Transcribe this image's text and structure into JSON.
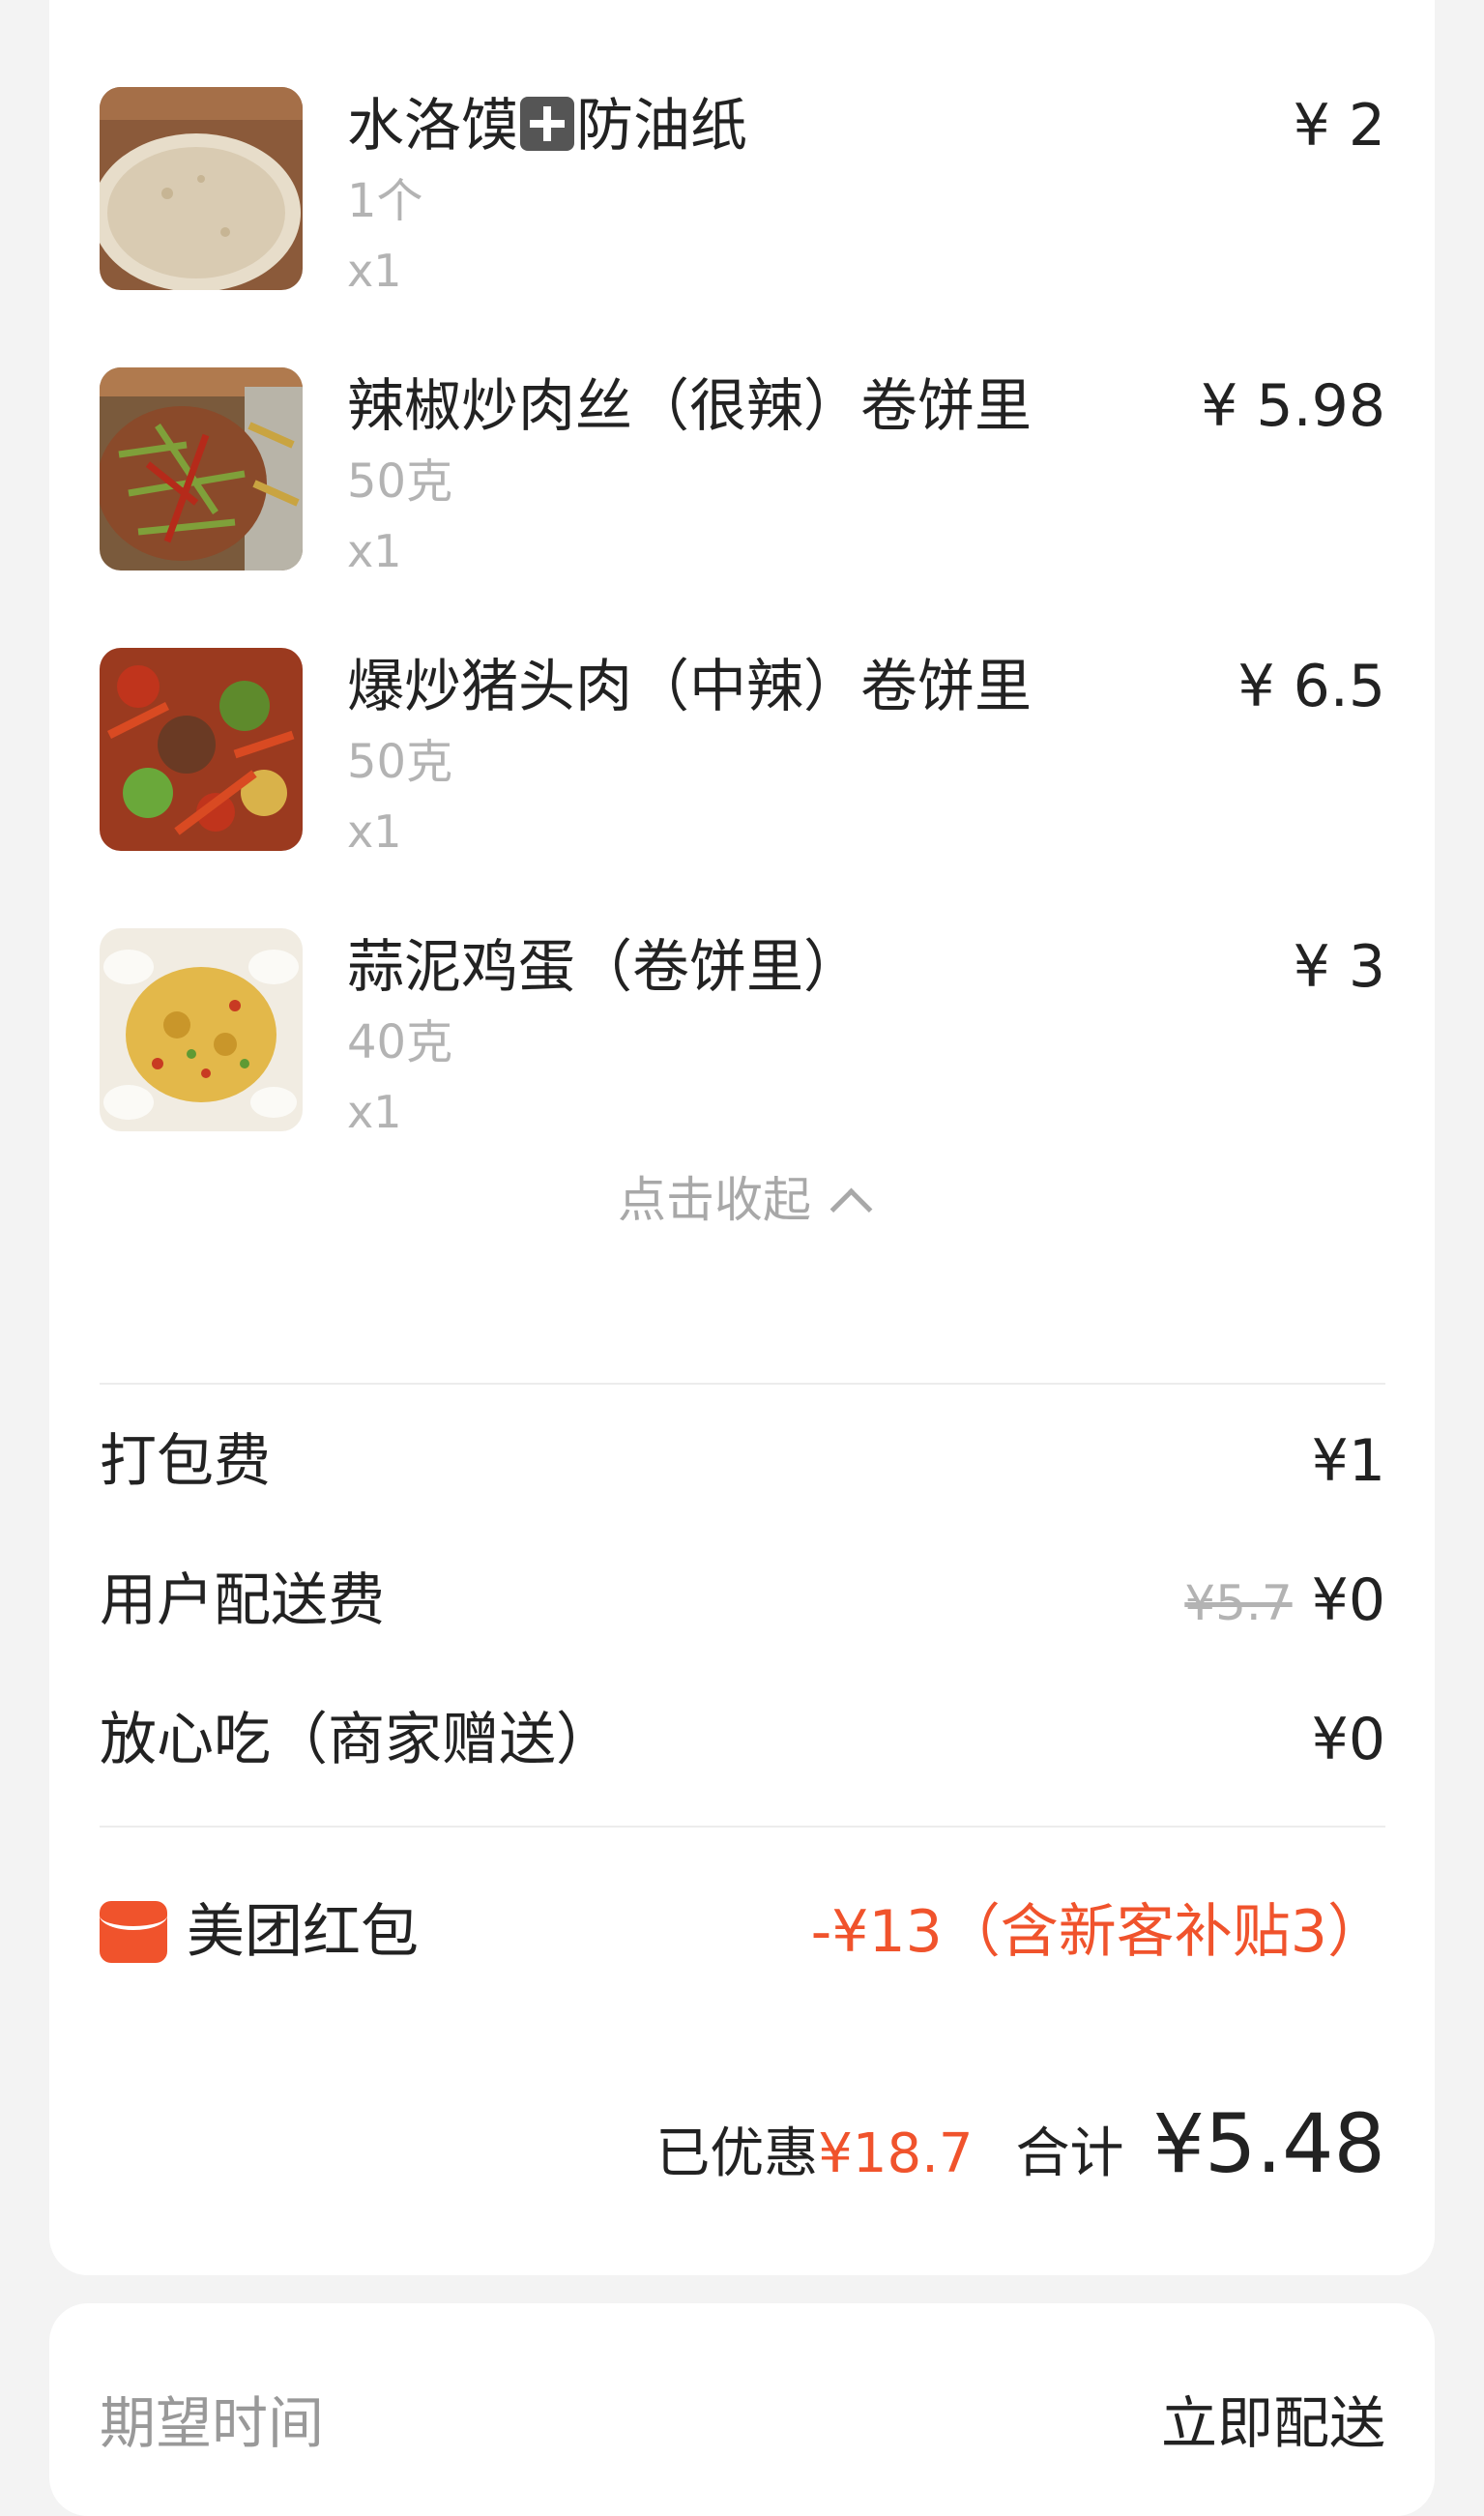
{
  "order": {
    "items": [
      {
        "name_a": "水洛馍",
        "name_b": "防油纸",
        "spec": "1个",
        "qty": "x1",
        "price": "¥ 2",
        "thumb_icon": "flatbread-photo"
      },
      {
        "name": "辣椒炒肉丝（很辣）卷饼里",
        "spec": "50克",
        "qty": "x1",
        "price": "¥ 5.98",
        "thumb_icon": "stir-fry-pork-photo"
      },
      {
        "name": "爆炒猪头肉（中辣）卷饼里",
        "spec": "50克",
        "qty": "x1",
        "price": "¥ 6.5",
        "thumb_icon": "spicy-pork-photo"
      },
      {
        "name": "蒜泥鸡蛋（卷饼里）",
        "spec": "40克",
        "qty": "x1",
        "price": "¥ 3",
        "thumb_icon": "garlic-egg-photo"
      }
    ],
    "collapse_label": "点击收起"
  },
  "fees": {
    "packing": {
      "label": "打包费",
      "value": "¥1"
    },
    "delivery": {
      "label": "用户配送费",
      "original": "¥5.7",
      "value": "¥0"
    },
    "assurance": {
      "label": "放心吃（商家赠送）",
      "value": "¥0"
    }
  },
  "redpack": {
    "label": "美团红包",
    "value": "-¥13（含新客补贴3）",
    "color": "#f0532c"
  },
  "summary": {
    "discount_label": "已优惠",
    "discount_value": "¥18.7",
    "total_label": "合计",
    "total_value": "¥5.48"
  },
  "delivery_time": {
    "label": "期望时间",
    "value": "立即配送"
  }
}
